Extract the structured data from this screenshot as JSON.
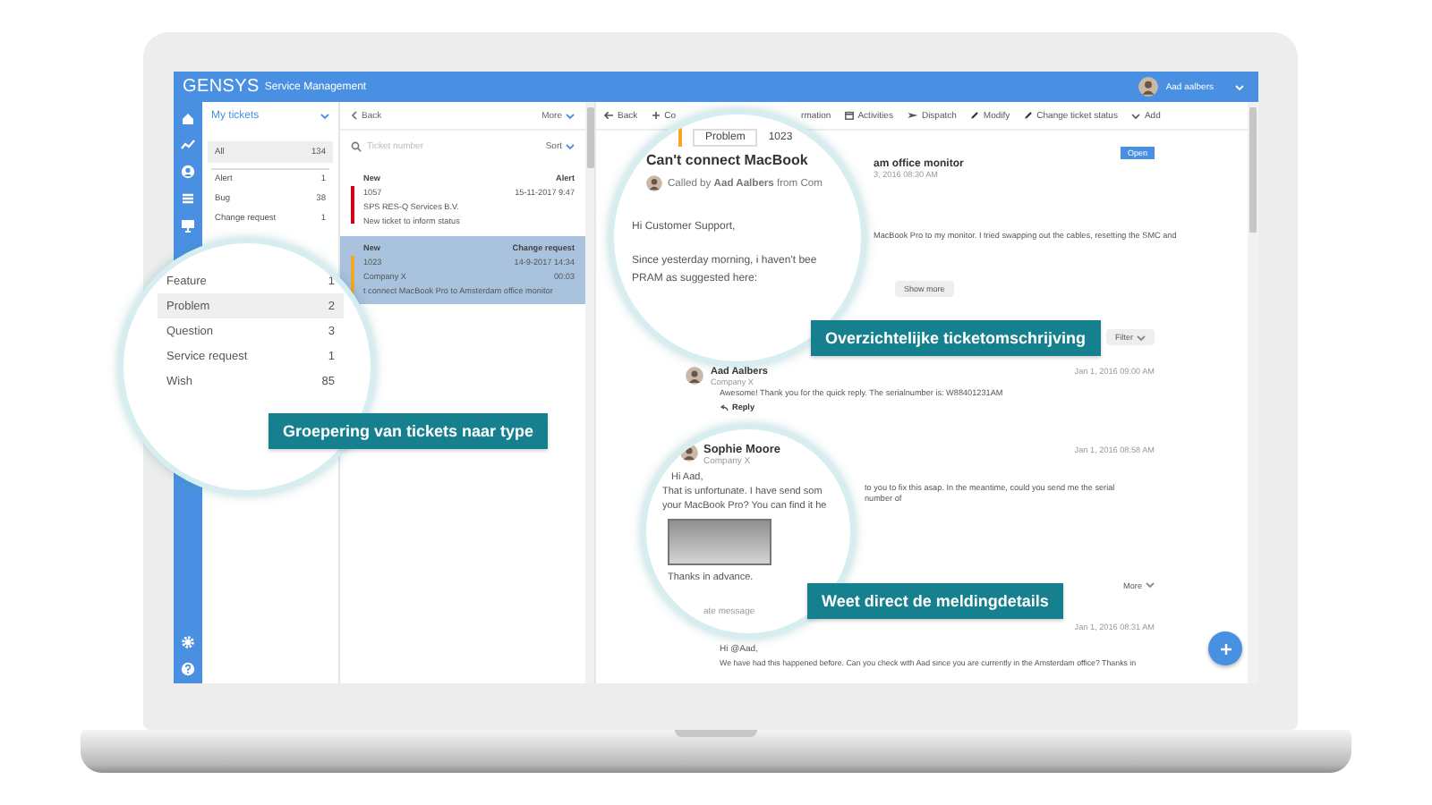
{
  "topbar": {
    "brand": "GENSYS",
    "product": "Service Management",
    "user": "Aad aalbers"
  },
  "filters": {
    "title": "My tickets",
    "items": [
      {
        "label": "All",
        "count": "134",
        "selected": true
      },
      {
        "label": "Alert",
        "count": "1",
        "selected": false
      },
      {
        "label": "Bug",
        "count": "38",
        "selected": false
      },
      {
        "label": "Change request",
        "count": "1",
        "selected": false
      }
    ]
  },
  "type_lens": {
    "items": [
      {
        "label": "Feature",
        "count": "1",
        "selected": false
      },
      {
        "label": "Problem",
        "count": "2",
        "selected": true
      },
      {
        "label": "Question",
        "count": "3",
        "selected": false
      },
      {
        "label": "Service request",
        "count": "1",
        "selected": false
      },
      {
        "label": "Wish",
        "count": "85",
        "selected": false
      }
    ]
  },
  "ticket_list": {
    "back": "Back",
    "more": "More",
    "search": {
      "placeholder": "Ticket number"
    },
    "sort": "Sort",
    "tickets": [
      {
        "status": "New",
        "type": "Alert",
        "number": "1057",
        "date": "15-11-2017 9:47",
        "company": "SPS RES-Q Services B.V.",
        "subject": "New ticket to inform status",
        "color": "#d0021b",
        "selected": false
      },
      {
        "status": "New",
        "type": "Change request",
        "number": "1023",
        "date": "14-9-2017 14:34",
        "company": "Company X",
        "time": "00:03",
        "subject": "t connect MacBook Pro to Amsterdam office monitor",
        "color": "#f5a623",
        "selected": true
      }
    ]
  },
  "toolbar": [
    {
      "kind": "back",
      "label": "Back"
    },
    {
      "kind": "create",
      "label": "Co"
    },
    {
      "kind": "plain",
      "label": "rmation"
    },
    {
      "kind": "calendar",
      "label": "Activities"
    },
    {
      "kind": "dispatch",
      "label": "Dispatch"
    },
    {
      "kind": "edit",
      "label": "Modify"
    },
    {
      "kind": "edit",
      "label": "Change ticket status"
    },
    {
      "kind": "add",
      "label": "Add"
    }
  ],
  "ticket_lens": {
    "type_tag": "Problem",
    "number": "1023",
    "title": "Can't connect MacBook",
    "caller": "Called by **Aad Aalbers** from Com",
    "greeting": "Hi Customer Support,",
    "lines": [
      "Since yesterday morning, i haven't bee",
      "PRAM as suggested here:"
    ]
  },
  "ticket": {
    "title_rest": "am office monitor",
    "date_rest": "3, 2016 08:30 AM",
    "status": "Open",
    "body_rest": "MacBook Pro to my monitor. I tried swapping out the cables, resetting the SMC and",
    "show_more": "Show more",
    "filter": "Filter"
  },
  "comments": [
    {
      "author": "Aad Aalbers",
      "company": "Company X",
      "date": "Jan 1, 2016 09:00 AM",
      "text": "Awesome! Thank you for the quick reply. The serialnumber is: W88401231AM",
      "reply": "Reply"
    }
  ],
  "message_lens": {
    "author": "Sophie Moore",
    "company": "Company X",
    "lines": [
      "Hi Aad,",
      "That is unfortunate. I have send som",
      "your MacBook Pro?  You can find it he"
    ],
    "closing": "Thanks in advance.",
    "footer": "ate message"
  },
  "message": {
    "date": "Jan 1, 2016 08:58 AM",
    "text_rest": "to you to fix this asap. In the meantime, could you send me the serial number of",
    "more": "More"
  },
  "private_message": {
    "date": "Jan 1, 2016 08:31 AM",
    "greeting": "Hi @Aad,",
    "text": "We have had this happened before. Can you check with Aad since you are currently in the Amsterdam office? Thanks in"
  },
  "callouts": [
    {
      "text": "Groepering van tickets naar type"
    },
    {
      "text": "Overzichtelijke ticketomschrijving"
    },
    {
      "text": "Weet direct de meldingdetails"
    }
  ]
}
